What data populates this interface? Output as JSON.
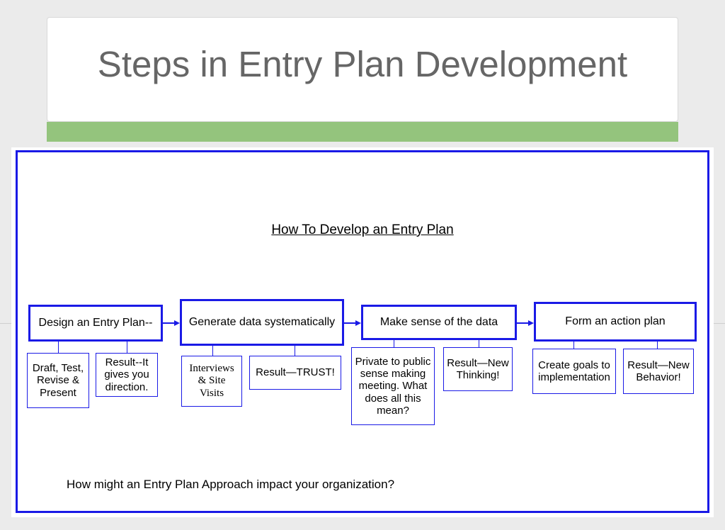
{
  "title": "Steps in Entry Plan Development",
  "diagram": {
    "heading": "How To Develop an Entry Plan",
    "footer_question": "How might an Entry Plan Approach impact your organization?",
    "steps": [
      {
        "label": "Design an Entry Plan--",
        "subs": [
          "Draft, Test, Revise & Present",
          "Result--It gives you direction."
        ]
      },
      {
        "label": "Generate data systematically",
        "subs": [
          "Interviews & Site Visits",
          "Result—TRUST!"
        ]
      },
      {
        "label": "Make sense of the data",
        "subs": [
          "Private to public sense making meeting. What does all this mean?",
          "Result—New Thinking!"
        ]
      },
      {
        "label": "Form an action plan",
        "subs": [
          "Create goals to implementation",
          "Result—New Behavior!"
        ]
      }
    ]
  }
}
